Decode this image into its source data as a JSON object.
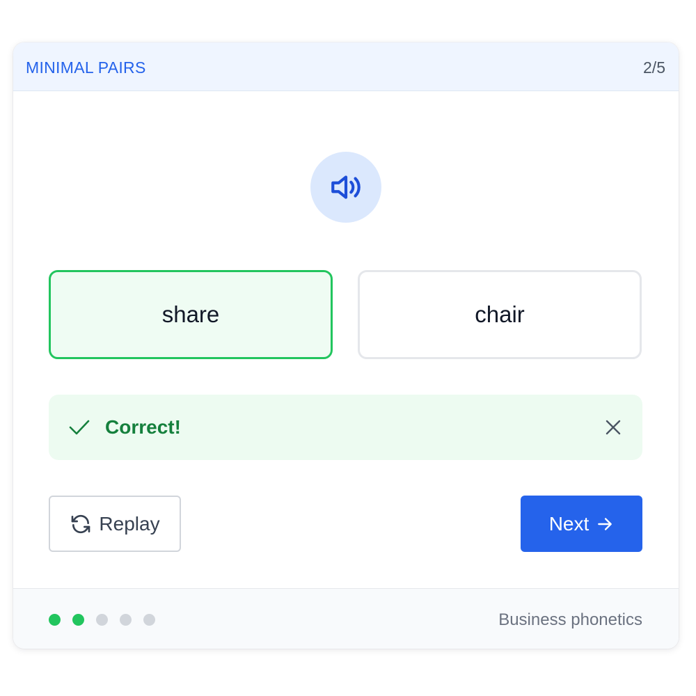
{
  "header": {
    "title": "MINIMAL PAIRS",
    "progress": "2/5"
  },
  "audio": {
    "icon": "speaker-icon",
    "color": "#1d4ed8"
  },
  "choices": [
    {
      "label": "share",
      "state": "selected-correct"
    },
    {
      "label": "chair",
      "state": "unselected"
    }
  ],
  "feedback": {
    "text": "Correct!",
    "icon": "check-icon",
    "close_icon": "close-icon",
    "color": "#15803d"
  },
  "actions": {
    "replay_label": "Replay",
    "replay_icon": "refresh-icon",
    "next_label": "Next",
    "next_icon": "arrow-right-icon"
  },
  "footer": {
    "progress_dots": [
      true,
      true,
      false,
      false,
      false
    ],
    "label": "Business phonetics"
  },
  "colors": {
    "accent": "#2563eb",
    "success": "#22c55e",
    "success_bg": "#edfbf1"
  }
}
